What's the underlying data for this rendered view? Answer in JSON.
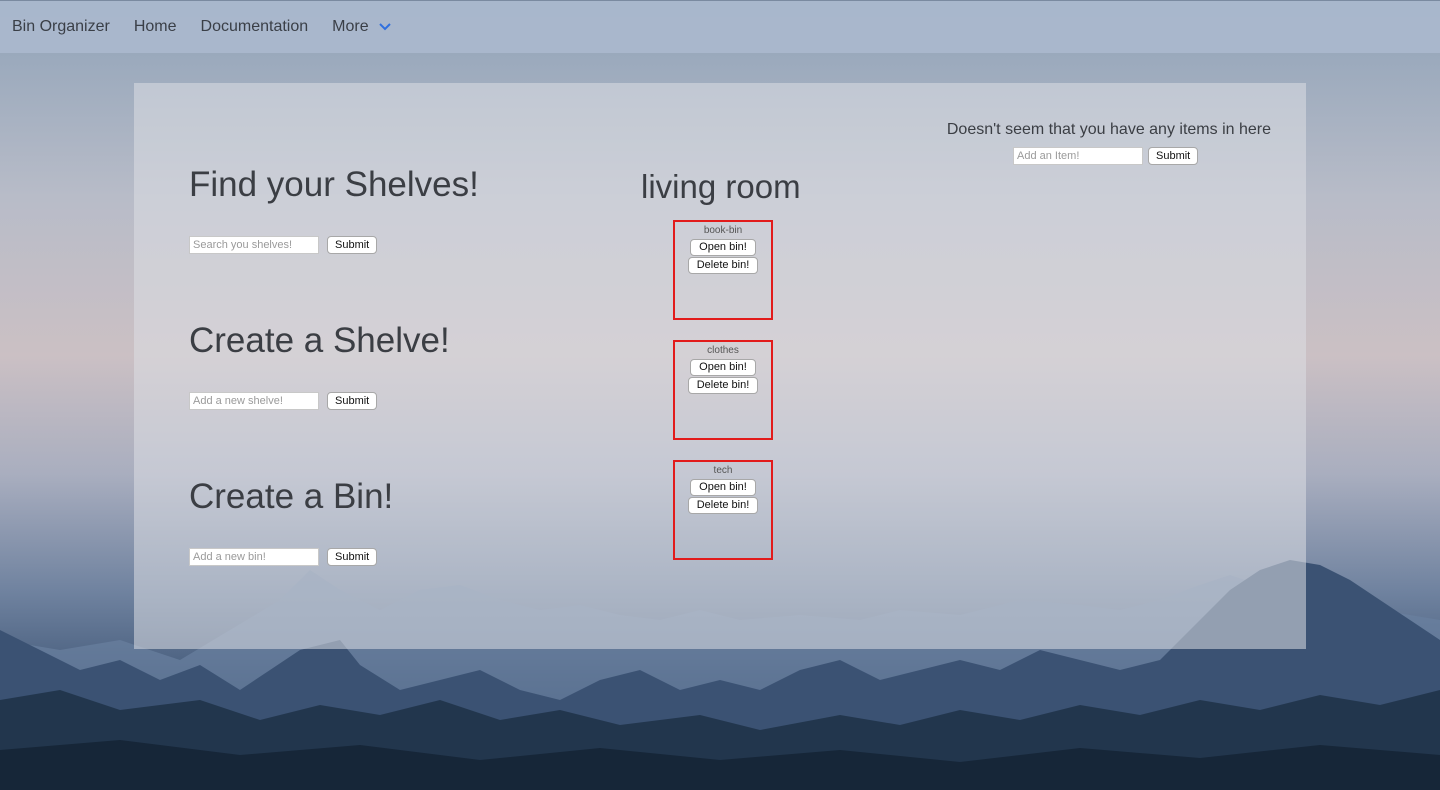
{
  "nav": {
    "brand": "Bin Organizer",
    "home": "Home",
    "documentation": "Documentation",
    "more": "More"
  },
  "find_shelves": {
    "title": "Find your Shelves!",
    "placeholder": "Search you shelves!",
    "submit": "Submit"
  },
  "create_shelve": {
    "title": "Create a Shelve!",
    "placeholder": "Add a new shelve!",
    "submit": "Submit"
  },
  "create_bin": {
    "title": "Create a Bin!",
    "placeholder": "Add a new bin!",
    "submit": "Submit"
  },
  "room": {
    "title": "living room",
    "bins": [
      {
        "name": "book-bin",
        "open": "Open bin!",
        "delete": "Delete bin!"
      },
      {
        "name": "clothes",
        "open": "Open bin!",
        "delete": "Delete bin!"
      },
      {
        "name": "tech",
        "open": "Open bin!",
        "delete": "Delete bin!"
      }
    ]
  },
  "items": {
    "message": "Doesn't seem that you have any items in here",
    "placeholder": "Add an Item!",
    "submit": "Submit"
  },
  "colors": {
    "bin_border": "#e21b1b",
    "nav_bg": "#aab9cd",
    "more_chevron": "#2f6fdf"
  }
}
